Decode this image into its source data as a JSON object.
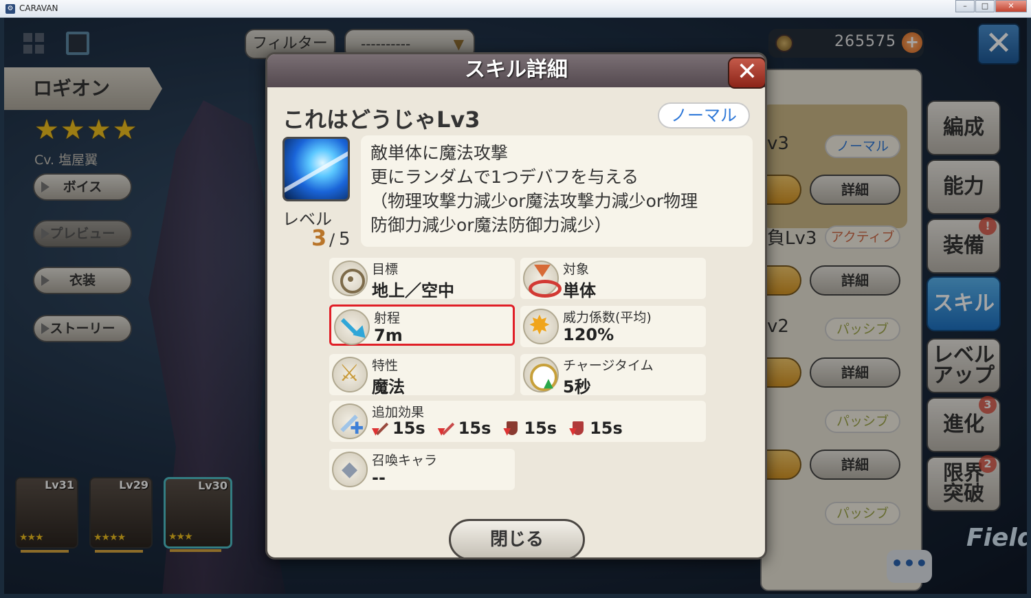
{
  "window": {
    "title": "CARAVAN",
    "minimize": "–",
    "maximize": "□",
    "close": "✕"
  },
  "topbar": {
    "filter_label": "フィルター",
    "filter_value": "----------",
    "currency": "265575",
    "plus": "+",
    "close": "✕"
  },
  "character": {
    "name": "ロギオン",
    "stars": "★★★★",
    "cv": "Cv. 塩屋翼",
    "buttons": [
      "ボイス",
      "プレビュー",
      "衣装",
      "ストーリー"
    ]
  },
  "portraits": [
    {
      "level": "Lv31",
      "stars": "★★★"
    },
    {
      "level": "Lv29",
      "stars": "★★★★"
    },
    {
      "level": "Lv30",
      "stars": "★★★"
    }
  ],
  "sidebar": {
    "tabs": [
      "編成",
      "能力",
      "装備",
      "スキル",
      "レベル\nアップ",
      "進化",
      "限界\n突破"
    ],
    "badges": {
      "equip": "!",
      "evolve": "3",
      "limit": "2"
    }
  },
  "skill_list": {
    "rows": [
      {
        "name": "v3",
        "tag": "ノーマル",
        "detail": "詳細"
      },
      {
        "name": "負Lv3",
        "tag": "アクティブ",
        "detail": "詳細"
      },
      {
        "name": "v2",
        "tag": "パッシブ",
        "detail": "詳細"
      },
      {
        "name": "",
        "tag": "パッシブ",
        "detail": "詳細"
      },
      {
        "name": "",
        "tag": "パッシブ",
        "detail": ""
      }
    ]
  },
  "chat": "•••",
  "field": "Field",
  "modal": {
    "title": "スキル詳細",
    "close_x": "✕",
    "skill_name": "これはどうじゃLv3",
    "skill_type": "ノーマル",
    "level_label": "レベル",
    "level_current": "3",
    "level_sep": "/",
    "level_max": "5",
    "description": [
      "敵単体に魔法攻撃",
      "更にランダムで1つデバフを与える",
      "（物理攻撃力減少or魔法攻撃力減少or物理",
      "防御力減少or魔法防御力減少）"
    ],
    "stats": {
      "target": {
        "label": "目標",
        "value": "地上／空中"
      },
      "target_type": {
        "label": "対象",
        "value": "単体"
      },
      "range": {
        "label": "射程",
        "value": "7m"
      },
      "power": {
        "label": "威力係数(平均)",
        "value": "120%"
      },
      "trait": {
        "label": "特性",
        "value": "魔法"
      },
      "charge": {
        "label": "チャージタイム",
        "value": "5秒"
      },
      "effect": {
        "label": "追加効果",
        "durations": [
          "15s",
          "15s",
          "15s",
          "15s"
        ]
      },
      "summon": {
        "label": "召喚キャラ",
        "value": "--"
      }
    },
    "close_button": "閉じる"
  }
}
